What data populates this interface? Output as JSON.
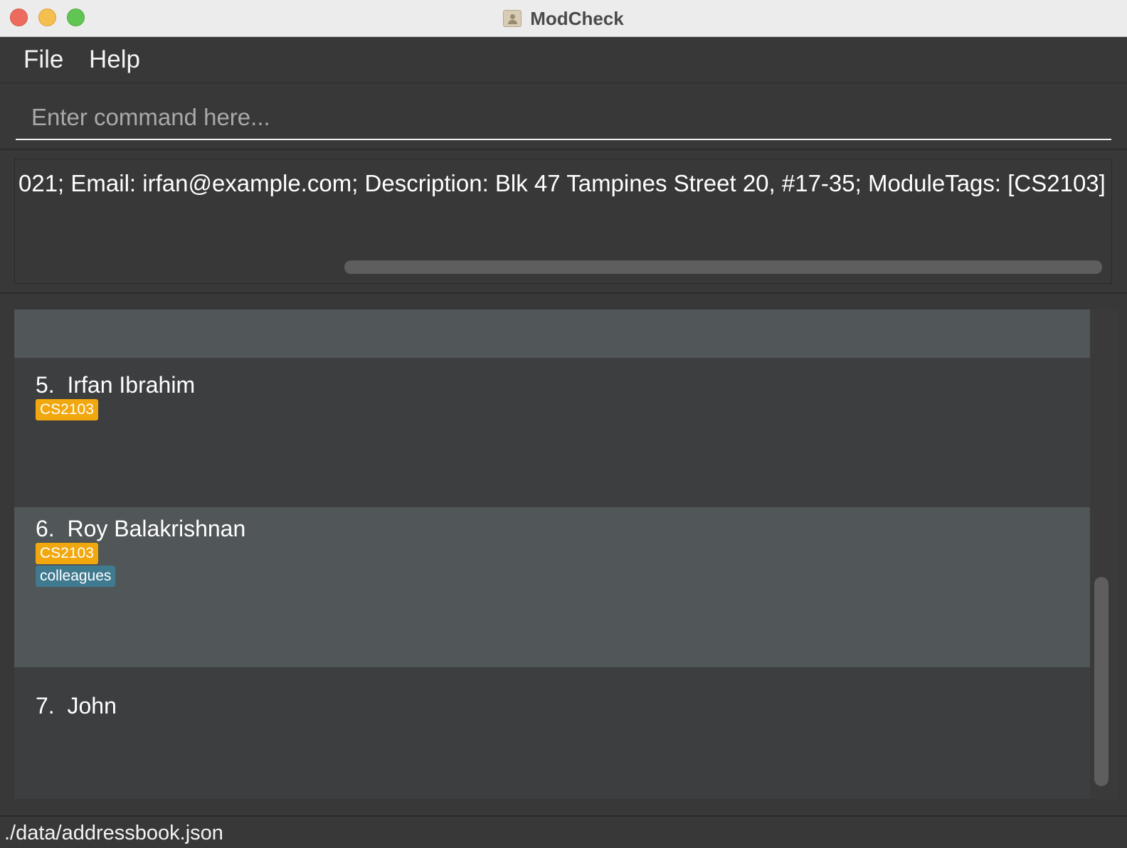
{
  "window": {
    "title": "ModCheck",
    "app_icon": "address-book-icon"
  },
  "menu": {
    "file_label": "File",
    "help_label": "Help"
  },
  "command": {
    "value": "",
    "placeholder": "Enter command here..."
  },
  "result": {
    "text": "021; Email: irfan@example.com; Description: Blk 47 Tampines Street 20, #17-35; ModuleTags: [CS2103]"
  },
  "persons": [
    {
      "index": "5.",
      "name": "Irfan Ibrahim",
      "module_tags": [
        "CS2103"
      ],
      "tags": []
    },
    {
      "index": "6.",
      "name": "Roy Balakrishnan",
      "module_tags": [
        "CS2103"
      ],
      "tags": [
        "colleagues"
      ]
    },
    {
      "index": "7.",
      "name": "John",
      "module_tags": [],
      "tags": []
    }
  ],
  "status": {
    "file_path": "./data/addressbook.json"
  },
  "colors": {
    "module_tag": "#f1a80f",
    "tag": "#3f7a8f",
    "selected_row": "#515658",
    "row": "#3c3e40"
  }
}
